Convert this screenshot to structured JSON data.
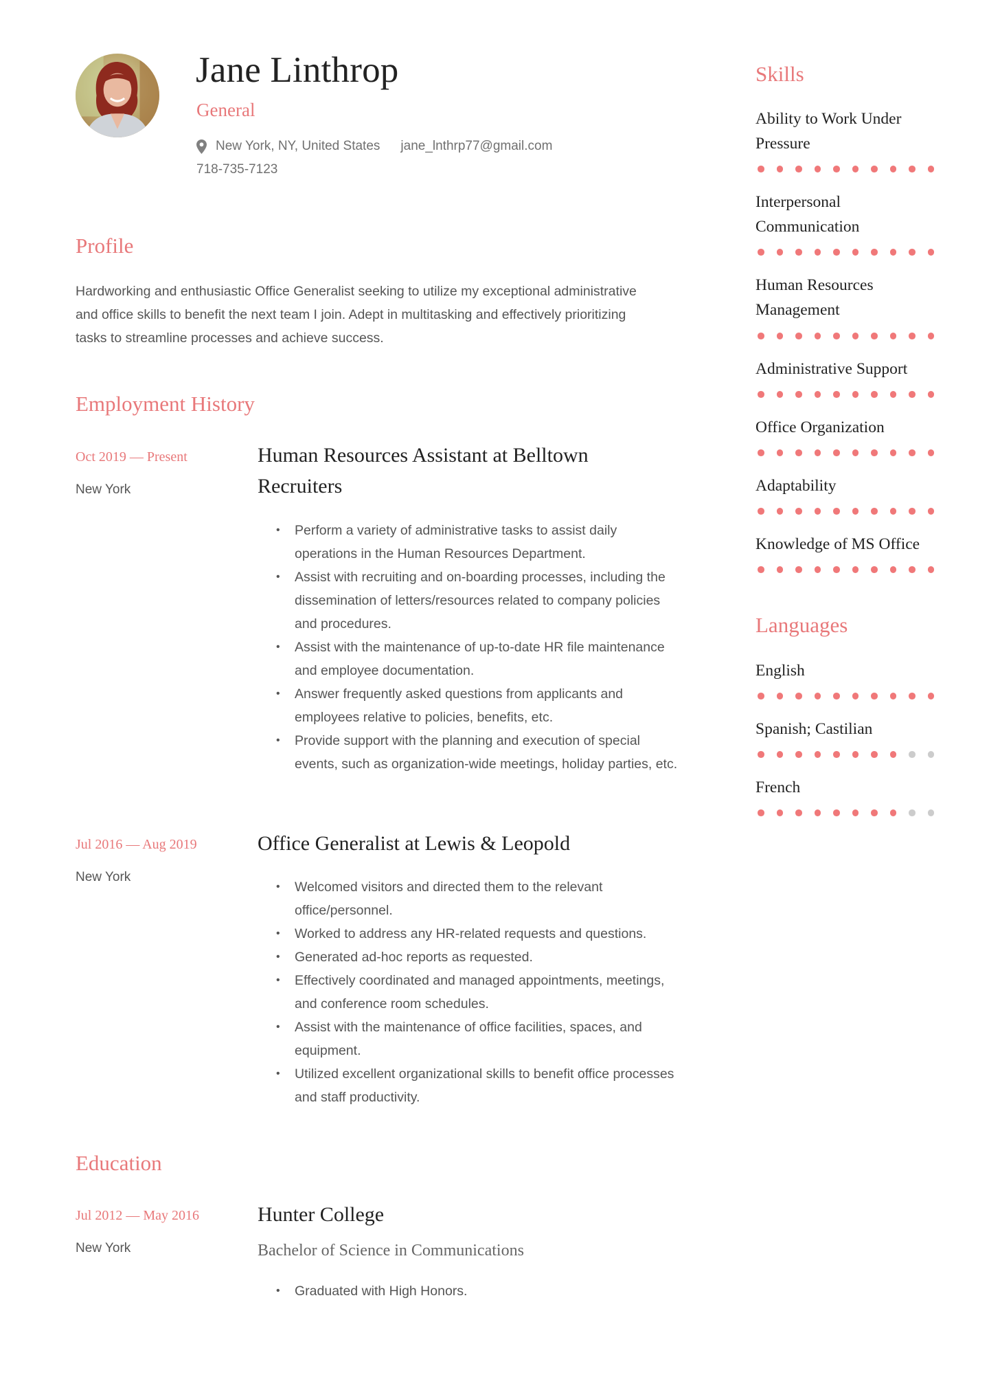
{
  "header": {
    "name": "Jane Linthrop",
    "job_title": "General",
    "location": "New York, NY, United States",
    "email": "jane_lnthrp77@gmail.com",
    "phone": "718-735-7123",
    "location_icon": "map-pin-icon"
  },
  "colors": {
    "accent": "#E8787A",
    "dot_filled": "#F07879",
    "dot_empty": "#CCCCCC",
    "heading_text": "#222222",
    "body_text": "#555555"
  },
  "profile": {
    "heading": "Profile",
    "text": "Hardworking and enthusiastic Office Generalist seeking to utilize my exceptional administrative and office skills to benefit the next team I join. Adept in multitasking and effectively prioritizing tasks to streamline processes and achieve success."
  },
  "employment": {
    "heading": "Employment History",
    "jobs": [
      {
        "dates": "Oct 2019 — Present",
        "location": "New York",
        "title": "Human Resources Assistant at Belltown Recruiters",
        "bullets": [
          "Perform a variety of administrative tasks to assist daily operations in the Human Resources Department.",
          "Assist with recruiting and on-boarding processes, including the dissemination of letters/resources related to company policies and procedures.",
          "Assist with the maintenance of up-to-date HR file maintenance and employee documentation.",
          "Answer frequently asked questions from applicants and employees relative to policies, benefits, etc.",
          "Provide support with the planning and execution of special events, such as organization-wide meetings, holiday parties, etc."
        ]
      },
      {
        "dates": "Jul 2016 — Aug 2019",
        "location": "New York",
        "title": "Office Generalist at Lewis & Leopold",
        "bullets": [
          "Welcomed visitors and directed them to the relevant office/personnel.",
          "Worked to address any HR-related requests and questions.",
          "Generated ad-hoc reports as requested.",
          "Effectively coordinated and managed appointments, meetings, and conference room schedules.",
          "Assist with the maintenance of office facilities, spaces, and equipment.",
          "Utilized excellent organizational skills to benefit office processes and staff productivity."
        ]
      }
    ]
  },
  "education": {
    "heading": "Education",
    "entries": [
      {
        "dates": "Jul 2012 — May 2016",
        "location": "New York",
        "school": "Hunter College",
        "degree": "Bachelor of Science in Communications",
        "bullets": [
          "Graduated with High Honors."
        ]
      }
    ]
  },
  "skills": {
    "heading": "Skills",
    "max_level": 10,
    "items": [
      {
        "name": "Ability to Work Under Pressure",
        "level": 10
      },
      {
        "name": "Interpersonal Communication",
        "level": 10
      },
      {
        "name": "Human Resources Management",
        "level": 10
      },
      {
        "name": "Administrative Support",
        "level": 10
      },
      {
        "name": "Office Organization",
        "level": 10
      },
      {
        "name": "Adaptability",
        "level": 10
      },
      {
        "name": "Knowledge of MS Office",
        "level": 10
      }
    ]
  },
  "languages": {
    "heading": "Languages",
    "max_level": 10,
    "items": [
      {
        "name": "English",
        "level": 10
      },
      {
        "name": "Spanish; Castilian",
        "level": 8
      },
      {
        "name": "French",
        "level": 8
      }
    ]
  }
}
